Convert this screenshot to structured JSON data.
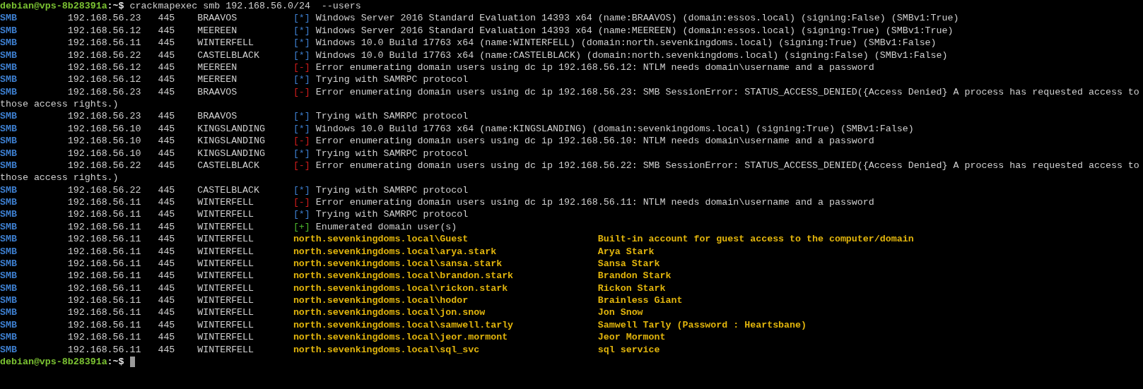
{
  "prompt": {
    "user_host": "debian@vps-8b28391a",
    "path": ":~$",
    "command": "crackmapexec smb 192.168.56.0/24  --users"
  },
  "lines": [
    {
      "kind": "status",
      "protocol": "SMB",
      "ip": "192.168.56.23",
      "port": "445",
      "host": "BRAAVOS",
      "marker": {
        "kind": "info",
        "text": "[*]"
      },
      "message": "Windows Server 2016 Standard Evaluation 14393 x64 (name:BRAAVOS) (domain:essos.local) (signing:False) (SMBv1:True)"
    },
    {
      "kind": "status",
      "protocol": "SMB",
      "ip": "192.168.56.12",
      "port": "445",
      "host": "MEEREEN",
      "marker": {
        "kind": "info",
        "text": "[*]"
      },
      "message": "Windows Server 2016 Standard Evaluation 14393 x64 (name:MEEREEN) (domain:essos.local) (signing:True) (SMBv1:True)"
    },
    {
      "kind": "status",
      "protocol": "SMB",
      "ip": "192.168.56.11",
      "port": "445",
      "host": "WINTERFELL",
      "marker": {
        "kind": "info",
        "text": "[*]"
      },
      "message": "Windows 10.0 Build 17763 x64 (name:WINTERFELL) (domain:north.sevenkingdoms.local) (signing:True) (SMBv1:False)"
    },
    {
      "kind": "status",
      "protocol": "SMB",
      "ip": "192.168.56.22",
      "port": "445",
      "host": "CASTELBLACK",
      "marker": {
        "kind": "info",
        "text": "[*]"
      },
      "message": "Windows 10.0 Build 17763 x64 (name:CASTELBLACK) (domain:north.sevenkingdoms.local) (signing:False) (SMBv1:False)"
    },
    {
      "kind": "status",
      "protocol": "SMB",
      "ip": "192.168.56.12",
      "port": "445",
      "host": "MEEREEN",
      "marker": {
        "kind": "error",
        "text": "[-]"
      },
      "message": "Error enumerating domain users using dc ip 192.168.56.12: NTLM needs domain\\username and a password"
    },
    {
      "kind": "status",
      "protocol": "SMB",
      "ip": "192.168.56.12",
      "port": "445",
      "host": "MEEREEN",
      "marker": {
        "kind": "info",
        "text": "[*]"
      },
      "message": "Trying with SAMRPC protocol"
    },
    {
      "kind": "status",
      "protocol": "SMB",
      "ip": "192.168.56.23",
      "port": "445",
      "host": "BRAAVOS",
      "marker": {
        "kind": "error",
        "text": "[-]"
      },
      "message": "Error enumerating domain users using dc ip 192.168.56.23: SMB SessionError: STATUS_ACCESS_DENIED({Access Denied} A process has requested access to"
    },
    {
      "kind": "wrap",
      "text": "those access rights.)"
    },
    {
      "kind": "status",
      "protocol": "SMB",
      "ip": "192.168.56.23",
      "port": "445",
      "host": "BRAAVOS",
      "marker": {
        "kind": "info",
        "text": "[*]"
      },
      "message": "Trying with SAMRPC protocol"
    },
    {
      "kind": "status",
      "protocol": "SMB",
      "ip": "192.168.56.10",
      "port": "445",
      "host": "KINGSLANDING",
      "marker": {
        "kind": "info",
        "text": "[*]"
      },
      "message": "Windows 10.0 Build 17763 x64 (name:KINGSLANDING) (domain:sevenkingdoms.local) (signing:True) (SMBv1:False)"
    },
    {
      "kind": "status",
      "protocol": "SMB",
      "ip": "192.168.56.10",
      "port": "445",
      "host": "KINGSLANDING",
      "marker": {
        "kind": "error",
        "text": "[-]"
      },
      "message": "Error enumerating domain users using dc ip 192.168.56.10: NTLM needs domain\\username and a password"
    },
    {
      "kind": "status",
      "protocol": "SMB",
      "ip": "192.168.56.10",
      "port": "445",
      "host": "KINGSLANDING",
      "marker": {
        "kind": "info",
        "text": "[*]"
      },
      "message": "Trying with SAMRPC protocol"
    },
    {
      "kind": "status",
      "protocol": "SMB",
      "ip": "192.168.56.22",
      "port": "445",
      "host": "CASTELBLACK",
      "marker": {
        "kind": "error",
        "text": "[-]"
      },
      "message": "Error enumerating domain users using dc ip 192.168.56.22: SMB SessionError: STATUS_ACCESS_DENIED({Access Denied} A process has requested access to"
    },
    {
      "kind": "wrap",
      "text": "those access rights.)"
    },
    {
      "kind": "status",
      "protocol": "SMB",
      "ip": "192.168.56.22",
      "port": "445",
      "host": "CASTELBLACK",
      "marker": {
        "kind": "info",
        "text": "[*]"
      },
      "message": "Trying with SAMRPC protocol"
    },
    {
      "kind": "status",
      "protocol": "SMB",
      "ip": "192.168.56.11",
      "port": "445",
      "host": "WINTERFELL",
      "marker": {
        "kind": "error",
        "text": "[-]"
      },
      "message": "Error enumerating domain users using dc ip 192.168.56.11: NTLM needs domain\\username and a password"
    },
    {
      "kind": "status",
      "protocol": "SMB",
      "ip": "192.168.56.11",
      "port": "445",
      "host": "WINTERFELL",
      "marker": {
        "kind": "info",
        "text": "[*]"
      },
      "message": "Trying with SAMRPC protocol"
    },
    {
      "kind": "status",
      "protocol": "SMB",
      "ip": "192.168.56.11",
      "port": "445",
      "host": "WINTERFELL",
      "marker": {
        "kind": "success",
        "text": "[+]"
      },
      "message": "Enumerated domain user(s)"
    },
    {
      "kind": "user",
      "protocol": "SMB",
      "ip": "192.168.56.11",
      "port": "445",
      "host": "WINTERFELL",
      "user": "north.sevenkingdoms.local\\Guest",
      "description": "Built-in account for guest access to the computer/domain"
    },
    {
      "kind": "user",
      "protocol": "SMB",
      "ip": "192.168.56.11",
      "port": "445",
      "host": "WINTERFELL",
      "user": "north.sevenkingdoms.local\\arya.stark",
      "description": "Arya Stark"
    },
    {
      "kind": "user",
      "protocol": "SMB",
      "ip": "192.168.56.11",
      "port": "445",
      "host": "WINTERFELL",
      "user": "north.sevenkingdoms.local\\sansa.stark",
      "description": "Sansa Stark"
    },
    {
      "kind": "user",
      "protocol": "SMB",
      "ip": "192.168.56.11",
      "port": "445",
      "host": "WINTERFELL",
      "user": "north.sevenkingdoms.local\\brandon.stark",
      "description": "Brandon Stark"
    },
    {
      "kind": "user",
      "protocol": "SMB",
      "ip": "192.168.56.11",
      "port": "445",
      "host": "WINTERFELL",
      "user": "north.sevenkingdoms.local\\rickon.stark",
      "description": "Rickon Stark"
    },
    {
      "kind": "user",
      "protocol": "SMB",
      "ip": "192.168.56.11",
      "port": "445",
      "host": "WINTERFELL",
      "user": "north.sevenkingdoms.local\\hodor",
      "description": "Brainless Giant"
    },
    {
      "kind": "user",
      "protocol": "SMB",
      "ip": "192.168.56.11",
      "port": "445",
      "host": "WINTERFELL",
      "user": "north.sevenkingdoms.local\\jon.snow",
      "description": "Jon Snow"
    },
    {
      "kind": "user",
      "protocol": "SMB",
      "ip": "192.168.56.11",
      "port": "445",
      "host": "WINTERFELL",
      "user": "north.sevenkingdoms.local\\samwell.tarly",
      "description": "Samwell Tarly (Password : Heartsbane)"
    },
    {
      "kind": "user",
      "protocol": "SMB",
      "ip": "192.168.56.11",
      "port": "445",
      "host": "WINTERFELL",
      "user": "north.sevenkingdoms.local\\jeor.mormont",
      "description": "Jeor Mormont"
    },
    {
      "kind": "user",
      "protocol": "SMB",
      "ip": "192.168.56.11",
      "port": "445",
      "host": "WINTERFELL",
      "user": "north.sevenkingdoms.local\\sql_svc",
      "description": "sql service"
    }
  ],
  "final_prompt": {
    "user_host": "debian@vps-8b28391a",
    "path": ":~$"
  }
}
